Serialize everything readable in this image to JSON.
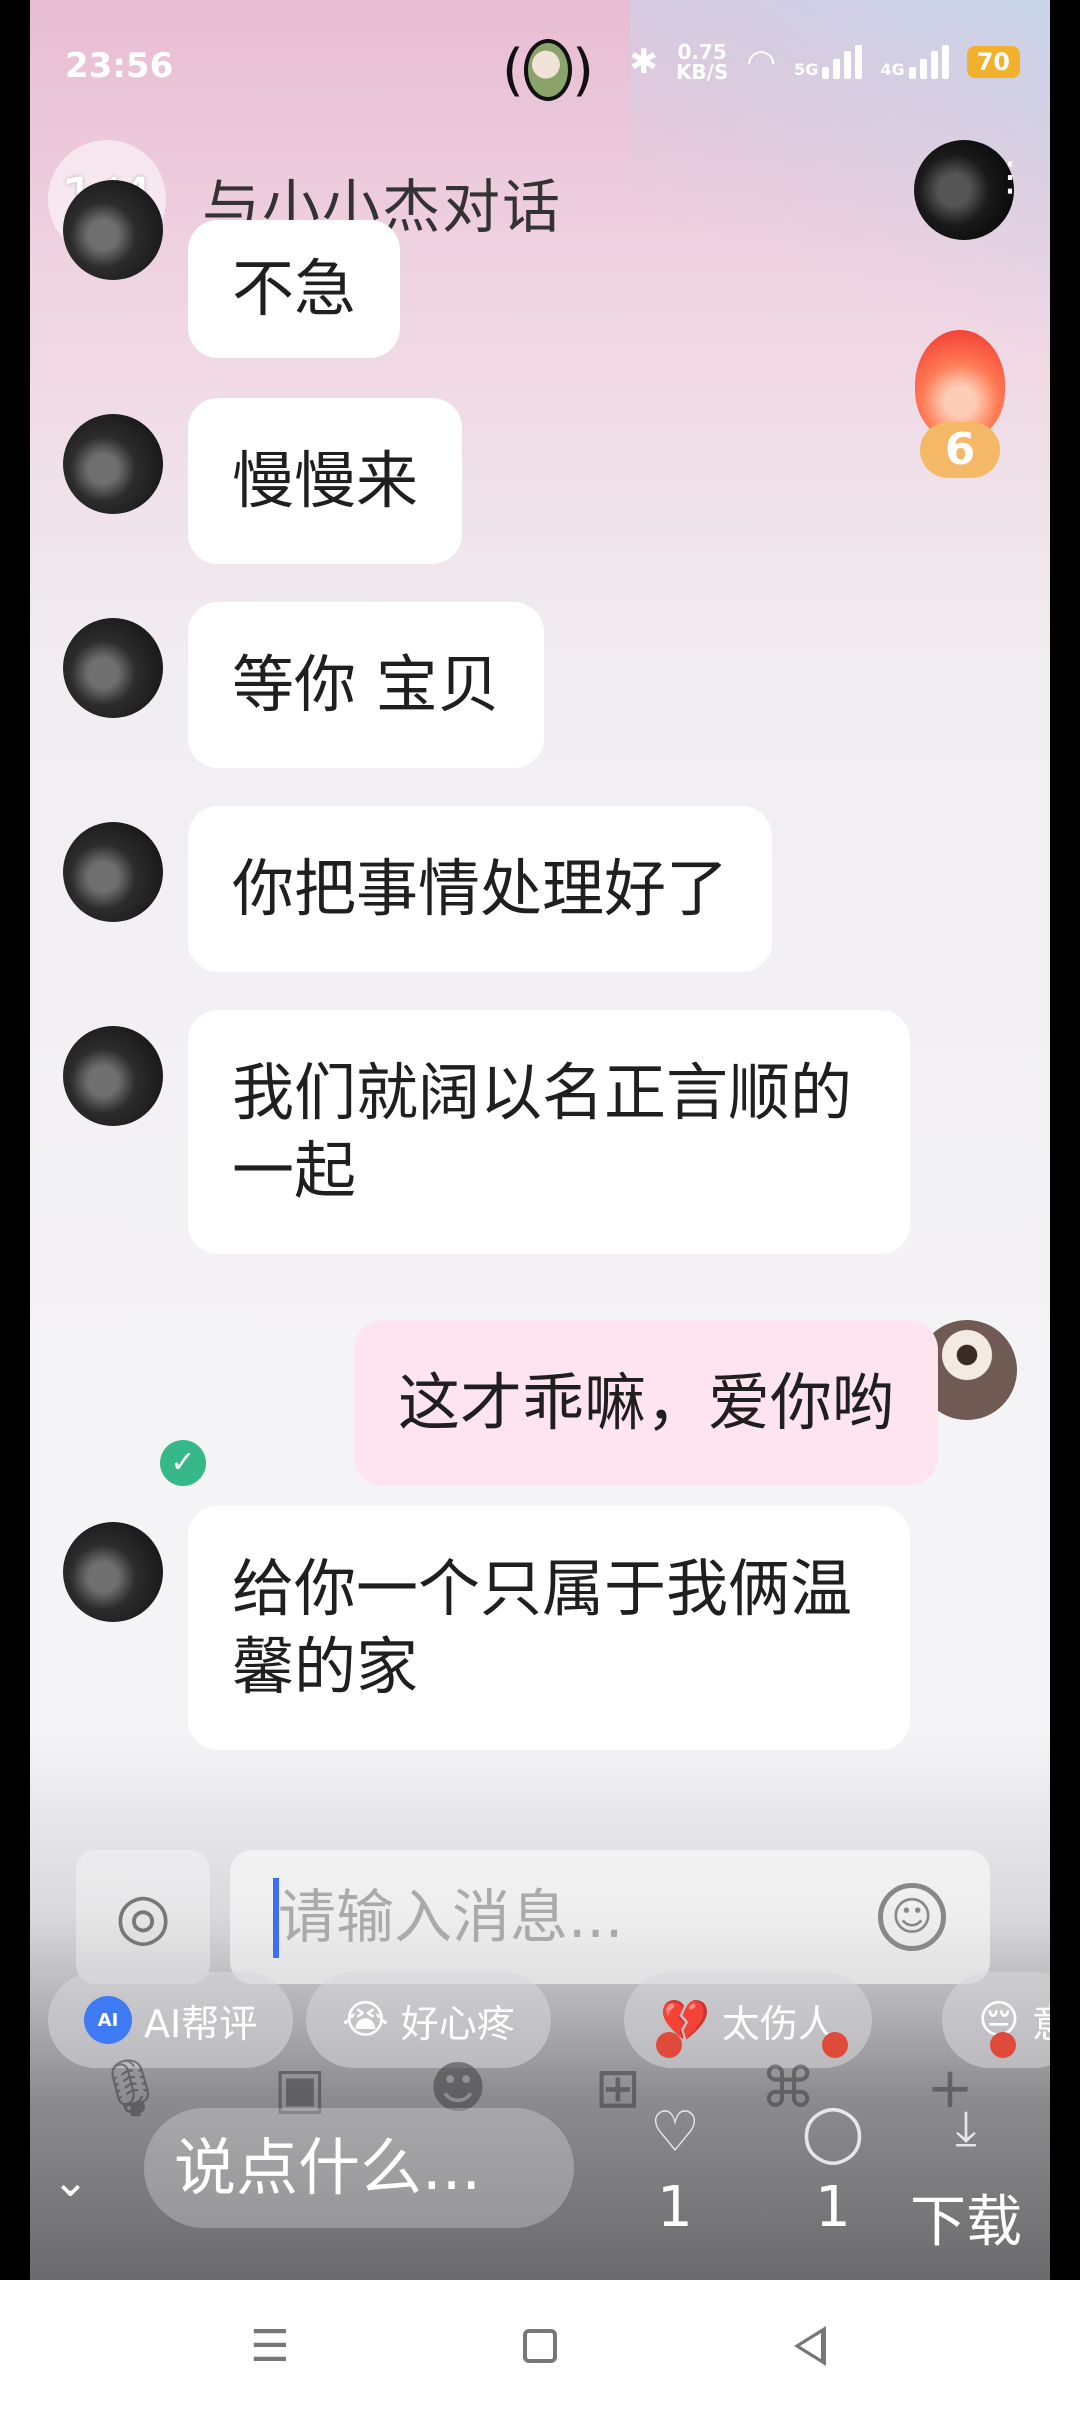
{
  "status_bar": {
    "time": "23:56",
    "net_speed_value": "0.75",
    "net_speed_unit": "KB/S",
    "signal_labels": [
      "5G",
      "4G"
    ],
    "battery": "70"
  },
  "header": {
    "page_counter": "1/4",
    "title": "与小小杰对话"
  },
  "fire_badge": {
    "count": "6"
  },
  "messages": [
    {
      "side": "in",
      "text": "不急"
    },
    {
      "side": "in",
      "text": "慢慢来"
    },
    {
      "side": "in",
      "text": "等你 宝贝"
    },
    {
      "side": "in",
      "text": "你把事情处理好了"
    },
    {
      "side": "in",
      "text": "我们就阔以名正言顺的一起"
    },
    {
      "side": "out",
      "text": "这才乖嘛，爱你哟"
    },
    {
      "side": "in",
      "text": "给你一个只属于我俩温馨的家"
    }
  ],
  "composer": {
    "placeholder": "请输入消息..."
  },
  "quick_chips": [
    {
      "label": "AI帮评",
      "icon": "ai-icon"
    },
    {
      "label": "好心疼",
      "icon": "crying-emoji"
    },
    {
      "label": "太伤人",
      "icon": "broken-heart-emoji"
    },
    {
      "label": "意",
      "icon": "pensive-emoji"
    }
  ],
  "overlay": {
    "comment_placeholder": "说点什么...",
    "likes": "1",
    "comments": "1",
    "download_label": "下载"
  }
}
